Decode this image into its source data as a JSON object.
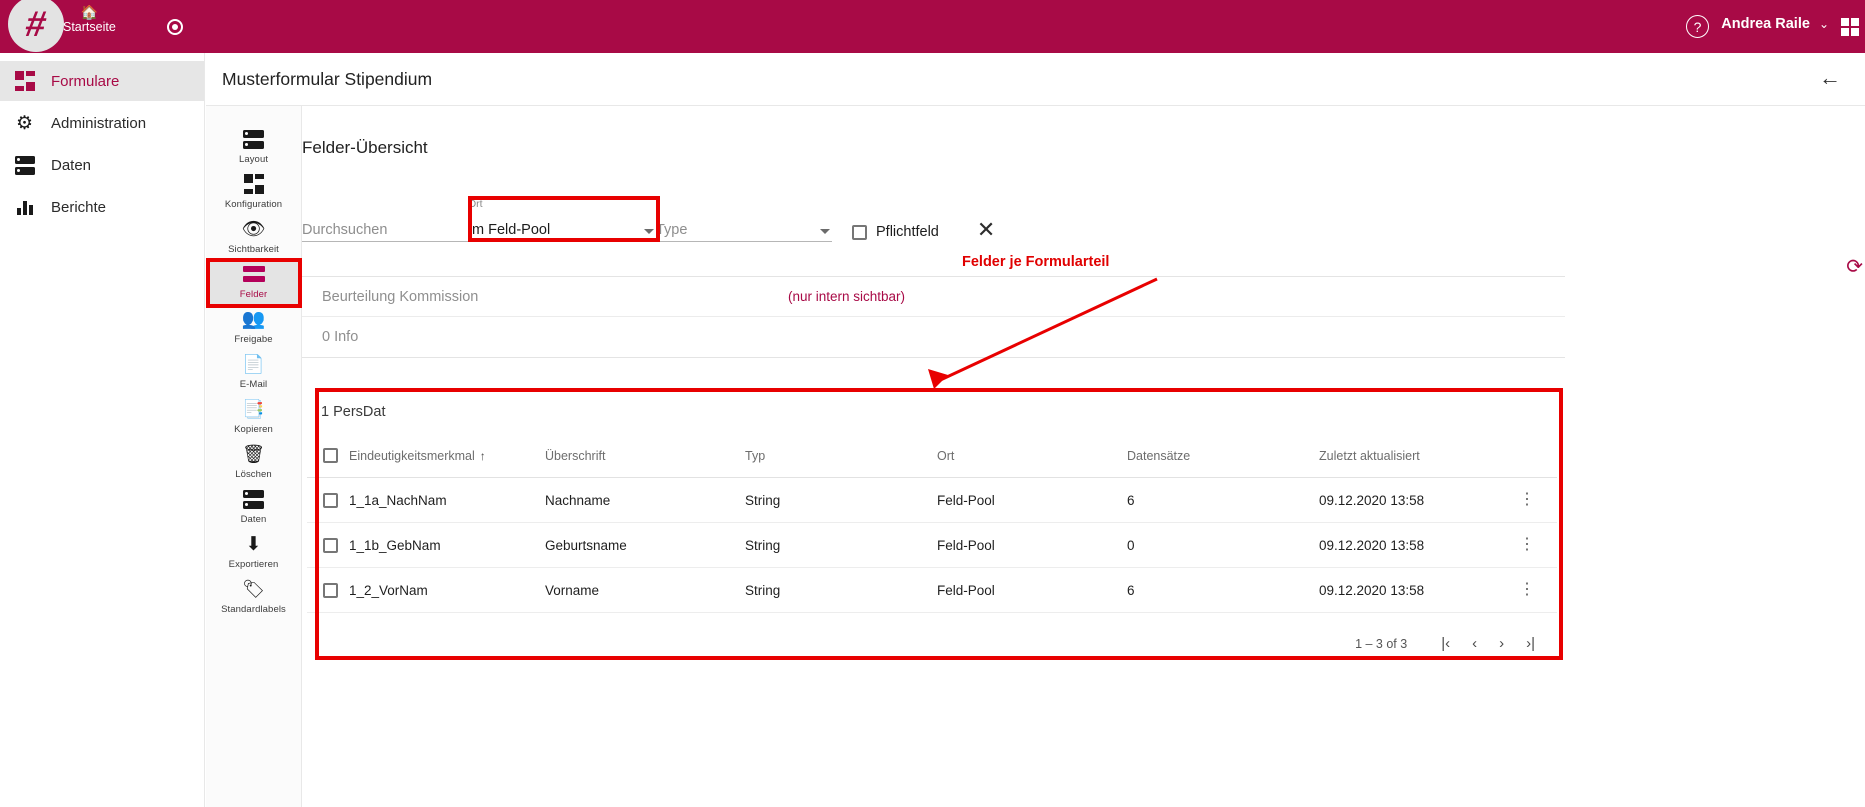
{
  "topbar": {
    "logo_glyph": "#",
    "home_label": "Startseite",
    "home_icon": "home-icon",
    "record_icon": "record-icon",
    "help_icon": "help-icon",
    "help_glyph": "?",
    "user_name": "Andrea Raile",
    "user_chevron": "⌄",
    "apps_icon": "apps-grid-icon"
  },
  "sidebar": {
    "items": [
      {
        "label": "Formulare",
        "icon": "grid-icon",
        "active": true
      },
      {
        "label": "Administration",
        "icon": "gear-icon",
        "active": false
      },
      {
        "label": "Daten",
        "icon": "server-icon",
        "active": false
      },
      {
        "label": "Berichte",
        "icon": "bar-chart-icon",
        "active": false
      }
    ]
  },
  "rail": {
    "items": [
      {
        "label": "Layout",
        "icon": "layout-icon",
        "active": false
      },
      {
        "label": "Konfiguration",
        "icon": "configuration-icon",
        "active": false
      },
      {
        "label": "Sichtbarkeit",
        "icon": "eye-icon",
        "active": false
      },
      {
        "label": "Felder",
        "icon": "fields-icon",
        "active": true
      },
      {
        "label": "Freigabe",
        "icon": "people-icon",
        "active": false
      },
      {
        "label": "E-Mail",
        "icon": "contact-card-icon",
        "active": false
      },
      {
        "label": "Kopieren",
        "icon": "copy-icon",
        "active": false
      },
      {
        "label": "Löschen",
        "icon": "trash-icon",
        "active": false
      },
      {
        "label": "Daten",
        "icon": "server-icon",
        "active": false
      },
      {
        "label": "Exportieren",
        "icon": "download-icon",
        "active": false
      },
      {
        "label": "Standardlabels",
        "icon": "tag-icon",
        "active": false
      }
    ]
  },
  "page": {
    "title": "Musterformular Stipendium",
    "back_icon": "arrow-left-icon",
    "panel_title": "Felder-Übersicht",
    "refresh_icon": "refresh-icon",
    "refresh_glyph": "⟳"
  },
  "filters": {
    "search_placeholder": "Durchsuchen",
    "ort_label": "Ort",
    "ort_value": "Im Feld-Pool",
    "type_placeholder": "Type",
    "required_label": "Pflichtfeld",
    "required_checked": false,
    "clear_icon": "close-icon",
    "clear_glyph": "✕",
    "dropdown_icon": "chevron-down-icon"
  },
  "sections": [
    {
      "name": "Beurteilung Kommission",
      "note": "(nur intern sichtbar)"
    },
    {
      "name": "0 Info",
      "note": ""
    }
  ],
  "annotation": {
    "text": "Felder je Formularteil",
    "color": "#e00000"
  },
  "table": {
    "group_title": "1 PersDat",
    "columns": [
      "Eindeutigkeitsmerkmal",
      "Überschrift",
      "Typ",
      "Ort",
      "Datensätze",
      "Zuletzt aktualisiert"
    ],
    "sort_column": "Eindeutigkeitsmerkmal",
    "sort_glyph": "↑",
    "rows": [
      {
        "uid": "1_1a_NachNam",
        "ueberschrift": "Nachname",
        "typ": "String",
        "ort": "Feld-Pool",
        "datensaetze": "6",
        "aktualisiert": "09.12.2020 13:58",
        "menu_glyph": "⋮"
      },
      {
        "uid": "1_1b_GebNam",
        "ueberschrift": "Geburtsname",
        "typ": "String",
        "ort": "Feld-Pool",
        "datensaetze": "0",
        "aktualisiert": "09.12.2020 13:58",
        "menu_glyph": "⋮"
      },
      {
        "uid": "1_2_VorNam",
        "ueberschrift": "Vorname",
        "typ": "String",
        "ort": "Feld-Pool",
        "datensaetze": "6",
        "aktualisiert": "09.12.2020 13:58",
        "menu_glyph": "⋮"
      }
    ],
    "paginator": {
      "range": "1 – 3 of 3",
      "first": "|‹",
      "prev": "‹",
      "next": "›",
      "last": "›|"
    }
  },
  "colors": {
    "brand": "#a80a46",
    "annotation_red": "#e80000",
    "accent_pink": "#b4005a"
  }
}
